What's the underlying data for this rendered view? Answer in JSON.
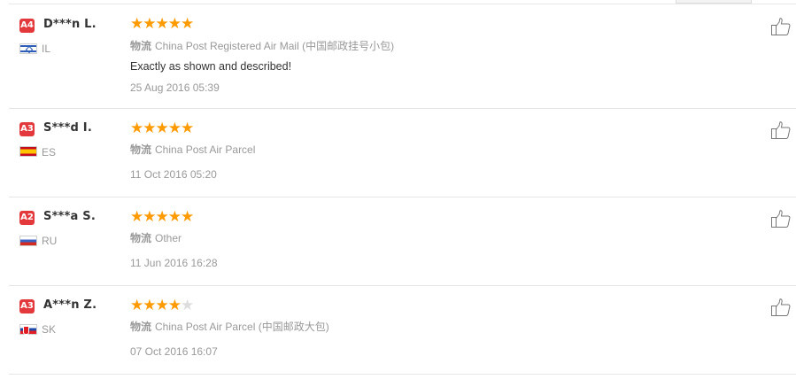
{
  "reviews": [
    {
      "level": "A4",
      "name": "D***n L.",
      "country": "IL",
      "flag": "israel-flag-icon",
      "rating": 5,
      "logistics_label": "物流",
      "logistics": "China Post Registered Air Mail (中国邮政挂号小包)",
      "feedback": "Exactly as shown and described!",
      "date": "25 Aug 2016 05:39"
    },
    {
      "level": "A3",
      "name": "S***d I.",
      "country": "ES",
      "flag": "spain-flag-icon",
      "rating": 5,
      "logistics_label": "物流",
      "logistics": "China Post Air Parcel",
      "feedback": "",
      "date": "11 Oct 2016 05:20"
    },
    {
      "level": "A2",
      "name": "S***a S.",
      "country": "RU",
      "flag": "russia-flag-icon",
      "rating": 5,
      "logistics_label": "物流",
      "logistics": "Other",
      "feedback": "",
      "date": "11 Jun 2016 16:28"
    },
    {
      "level": "A3",
      "name": "A***n Z.",
      "country": "SK",
      "flag": "slovakia-flag-icon",
      "rating": 4,
      "logistics_label": "物流",
      "logistics": "China Post Air Parcel (中国邮政大包)",
      "feedback": "",
      "date": "07 Oct 2016 16:07"
    }
  ],
  "colors": {
    "badge": "#e4393c",
    "star_filled": "#ff9a00",
    "star_empty": "#dddddd",
    "muted_text": "#999999"
  },
  "icons": {
    "helpful": "thumbs-up-icon",
    "rating": "star-icon"
  }
}
